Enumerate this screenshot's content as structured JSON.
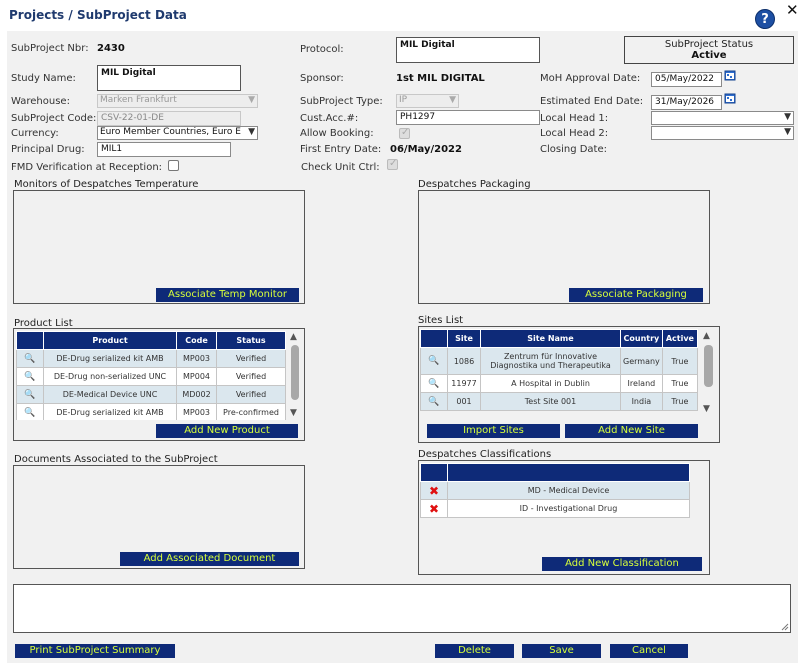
{
  "window": {
    "title": "Projects / SubProject Data",
    "help_glyph": "?",
    "close_glyph": "✕"
  },
  "header": {
    "subproject_nbr_label": "SubProject Nbr:",
    "subproject_nbr": "2430",
    "protocol_label": "Protocol:",
    "protocol_value": "MIL Digital",
    "status_title": "SubProject Status",
    "status_value": "Active",
    "study_name_label": "Study Name:",
    "study_name_value": "MIL Digital",
    "sponsor_label": "Sponsor:",
    "sponsor_value": "1st MIL DIGITAL",
    "moh_label": "MoH Approval Date:",
    "moh_value": "05/May/2022",
    "warehouse_label": "Warehouse:",
    "warehouse_value": "Marken Frankfurt",
    "subproject_type_label": "SubProject Type:",
    "subproject_type_value": "IP",
    "est_end_label": "Estimated End Date:",
    "est_end_value": "31/May/2026",
    "subproject_code_label": "SubProject Code:",
    "subproject_code_value": "CSV-22-01-DE",
    "cust_acc_label": "Cust.Acc.#:",
    "cust_acc_value": "PH1297",
    "local_head1_label": "Local Head 1:",
    "local_head1_value": "",
    "currency_label": "Currency:",
    "currency_value": "Euro Member Countries, Euro E",
    "allow_booking_label": "Allow Booking:",
    "local_head2_label": "Local Head 2:",
    "local_head2_value": "",
    "principal_drug_label": "Principal Drug:",
    "principal_drug_value": "MIL1",
    "first_entry_label": "First Entry Date:",
    "first_entry_value": "06/May/2022",
    "closing_date_label": "Closing Date:",
    "fmd_label": "FMD Verification at Reception:",
    "check_unit_label": "Check Unit Ctrl:"
  },
  "monitors": {
    "title": "Monitors of Despatches Temperature",
    "button": "Associate Temp Monitor"
  },
  "packaging": {
    "title": "Despatches Packaging",
    "button": "Associate Packaging"
  },
  "products": {
    "title": "Product List",
    "columns": [
      "Product",
      "Code",
      "Status"
    ],
    "rows": [
      {
        "product": "DE-Drug serialized kit AMB",
        "code": "MP003",
        "status": "Verified"
      },
      {
        "product": "DE-Drug non-serialized UNC",
        "code": "MP004",
        "status": "Verified"
      },
      {
        "product": "DE-Medical Device UNC",
        "code": "MD002",
        "status": "Verified"
      },
      {
        "product": "DE-Drug serialized kit AMB",
        "code": "MP003",
        "status": "Pre-confirmed"
      }
    ],
    "button": "Add New Product"
  },
  "sites": {
    "title": "Sites List",
    "columns": [
      "Site",
      "Site Name",
      "Country",
      "Active"
    ],
    "rows": [
      {
        "site": "1086",
        "name": "Zentrum für Innovative Diagnostika und Therapeutika",
        "country": "Germany",
        "active": "True"
      },
      {
        "site": "11977",
        "name": "A Hospital in Dublin",
        "country": "Ireland",
        "active": "True"
      },
      {
        "site": "001",
        "name": "Test Site 001",
        "country": "India",
        "active": "True"
      }
    ],
    "import_button": "Import Sites",
    "add_button": "Add New Site"
  },
  "documents": {
    "title": "Documents Associated to the SubProject",
    "button": "Add Associated Document"
  },
  "classifications": {
    "title": "Despatches Classifications",
    "rows": [
      "MD - Medical Device",
      "ID - Investigational Drug"
    ],
    "button": "Add New Classification"
  },
  "footer": {
    "print_button": "Print SubProject Summary",
    "delete_button": "Delete",
    "save_button": "Save",
    "cancel_button": "Cancel"
  },
  "colors": {
    "button_bg": "#0e2a78",
    "button_text": "#d8ff3a",
    "title_text": "#1f3a6e",
    "row_alt": "#dbe7ee"
  }
}
